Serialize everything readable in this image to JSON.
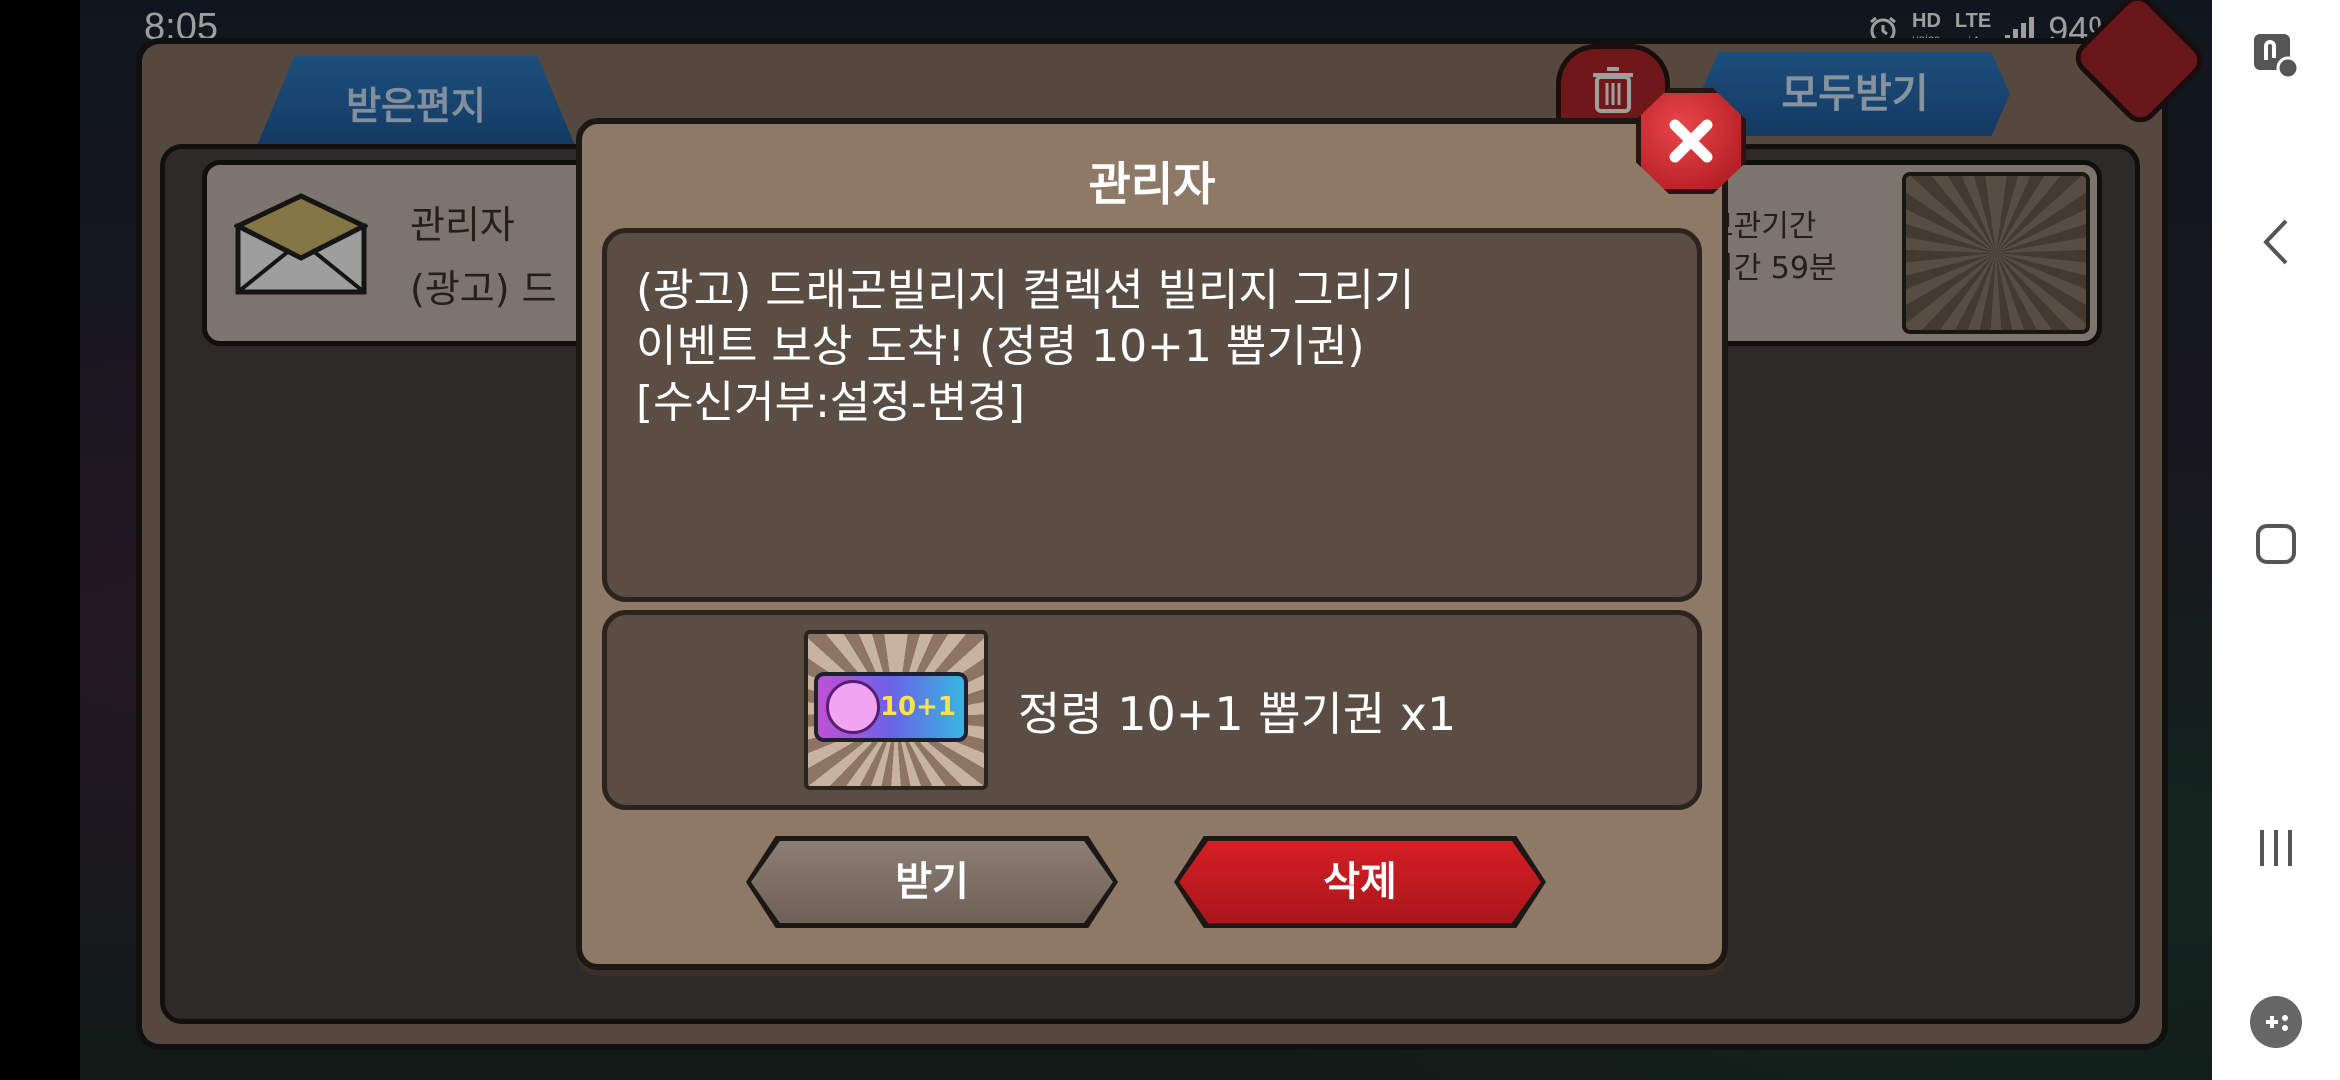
{
  "status_bar": {
    "time": "8:05",
    "hd_label": "HD",
    "voice_label": "voice",
    "lte_label": "LTE",
    "battery_percent": "94%"
  },
  "mailbox": {
    "tab_label": "받은편지",
    "receive_all_label": "모두받기",
    "mail": {
      "sender": "관리자",
      "preview": "(광고) 드",
      "retention_line1": "보관기간",
      "retention_line2": "시간 59분"
    }
  },
  "modal": {
    "title": "관리자",
    "message_lines": [
      "(광고) 드래곤빌리지 컬렉션 빌리지 그리기",
      "이벤트 보상 도착! (정령 10+1 뽑기권)",
      "[수신거부:설정-변경]"
    ],
    "reward": {
      "ticket_badge": "10+1",
      "label": "정령 10+1 뽑기권 x1"
    },
    "receive_label": "받기",
    "delete_label": "삭제"
  },
  "icons": {
    "trash": "trash-icon",
    "close": "close-icon",
    "envelope": "envelope-icon",
    "nav_back": "back-icon",
    "nav_home": "home-icon",
    "nav_recent": "recent-apps-icon"
  },
  "colors": {
    "modal_bg": "#8e7866",
    "delete_red": "#c9191f",
    "tab_blue": "#2a73bd"
  }
}
